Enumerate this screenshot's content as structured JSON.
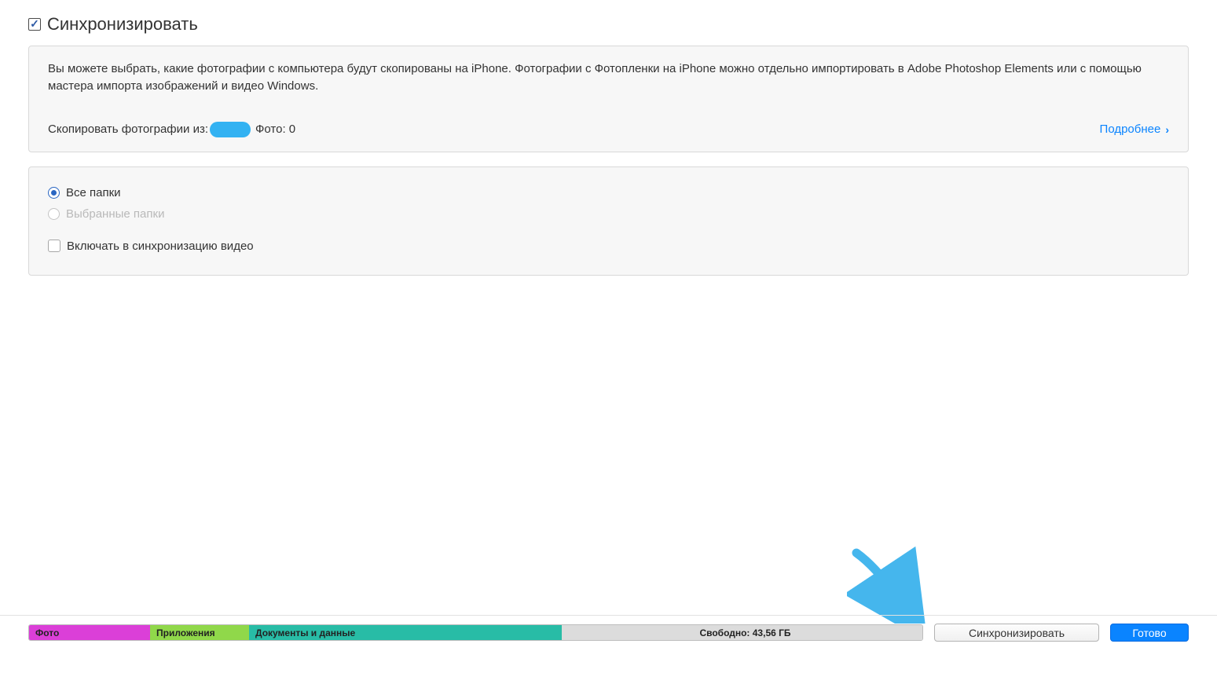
{
  "header": {
    "sync_checkbox_checked": true,
    "title": "Синхронизировать"
  },
  "info_panel": {
    "description": "Вы можете выбрать, какие фотографии с компьютера будут скопированы на iPhone. Фотографии с Фотопленки на iPhone можно отдельно импортировать в Adobe Photoshop Elements или с помощью мастера импорта изображений и видео Windows.",
    "copy_from_label": "Скопировать фотографии из:",
    "photo_count_label": "Фото: 0",
    "more_link": "Подробнее"
  },
  "options_panel": {
    "all_folders": "Все папки",
    "selected_folders": "Выбранные папки",
    "include_video": "Включать в синхронизацию видео"
  },
  "footer": {
    "segments": {
      "photo": "Фото",
      "apps": "Приложения",
      "docs": "Документы и данные",
      "free": "Свободно: 43,56 ГБ"
    },
    "sync_button": "Синхронизировать",
    "done_button": "Готово"
  }
}
